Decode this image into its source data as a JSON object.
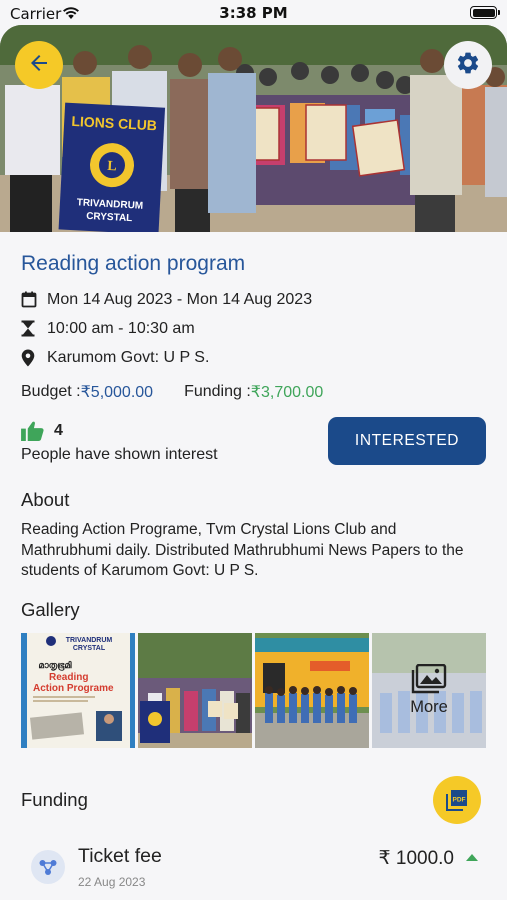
{
  "status_bar": {
    "carrier": "Carrier",
    "time": "3:38 PM"
  },
  "hero": {
    "banner_text": [
      "LIONS CLUB",
      "TRIVANDRUM",
      "CRYSTAL"
    ]
  },
  "event": {
    "title": "Reading action program",
    "dates": "Mon 14 Aug 2023 - Mon 14 Aug 2023",
    "time": "10:00 am - 10:30 am",
    "location": "Karumom Govt: U P S.",
    "budget_label": "Budget : ",
    "budget_value": "₹5,000.00",
    "funding_label": "Funding : ",
    "funding_value": "₹3,700.00"
  },
  "interest": {
    "count": "4",
    "text": "People have shown interest",
    "button_label": "INTERESTED"
  },
  "about": {
    "title": "About",
    "text": "Reading Action  Programe,  Tvm Crystal  Lions  Club and Mathrubhumi daily. Distributed  Mathrubhumi News Papers to the students  of Karumom Govt: U P S."
  },
  "gallery": {
    "title": "Gallery",
    "poster_lines": [
      "TRIVANDRUM",
      "CRYSTAL",
      "മാതൃഭൂമി",
      "Reading",
      "Action Programe"
    ],
    "more_label": "More"
  },
  "funding": {
    "title": "Funding",
    "items": [
      {
        "name": "Ticket fee",
        "date": "22 Aug 2023",
        "amount": "₹ 1000.0"
      }
    ]
  },
  "colors": {
    "accent_blue": "#1b4a8a",
    "title_blue": "#27569a",
    "green": "#3fa55a",
    "yellow": "#f5c927"
  },
  "icons": [
    "back-arrow-icon",
    "gear-icon",
    "calendar-icon",
    "hourglass-icon",
    "location-pin-icon",
    "thumbs-up-icon",
    "image-gallery-icon",
    "pdf-icon",
    "share-nodes-icon",
    "wifi-icon"
  ]
}
